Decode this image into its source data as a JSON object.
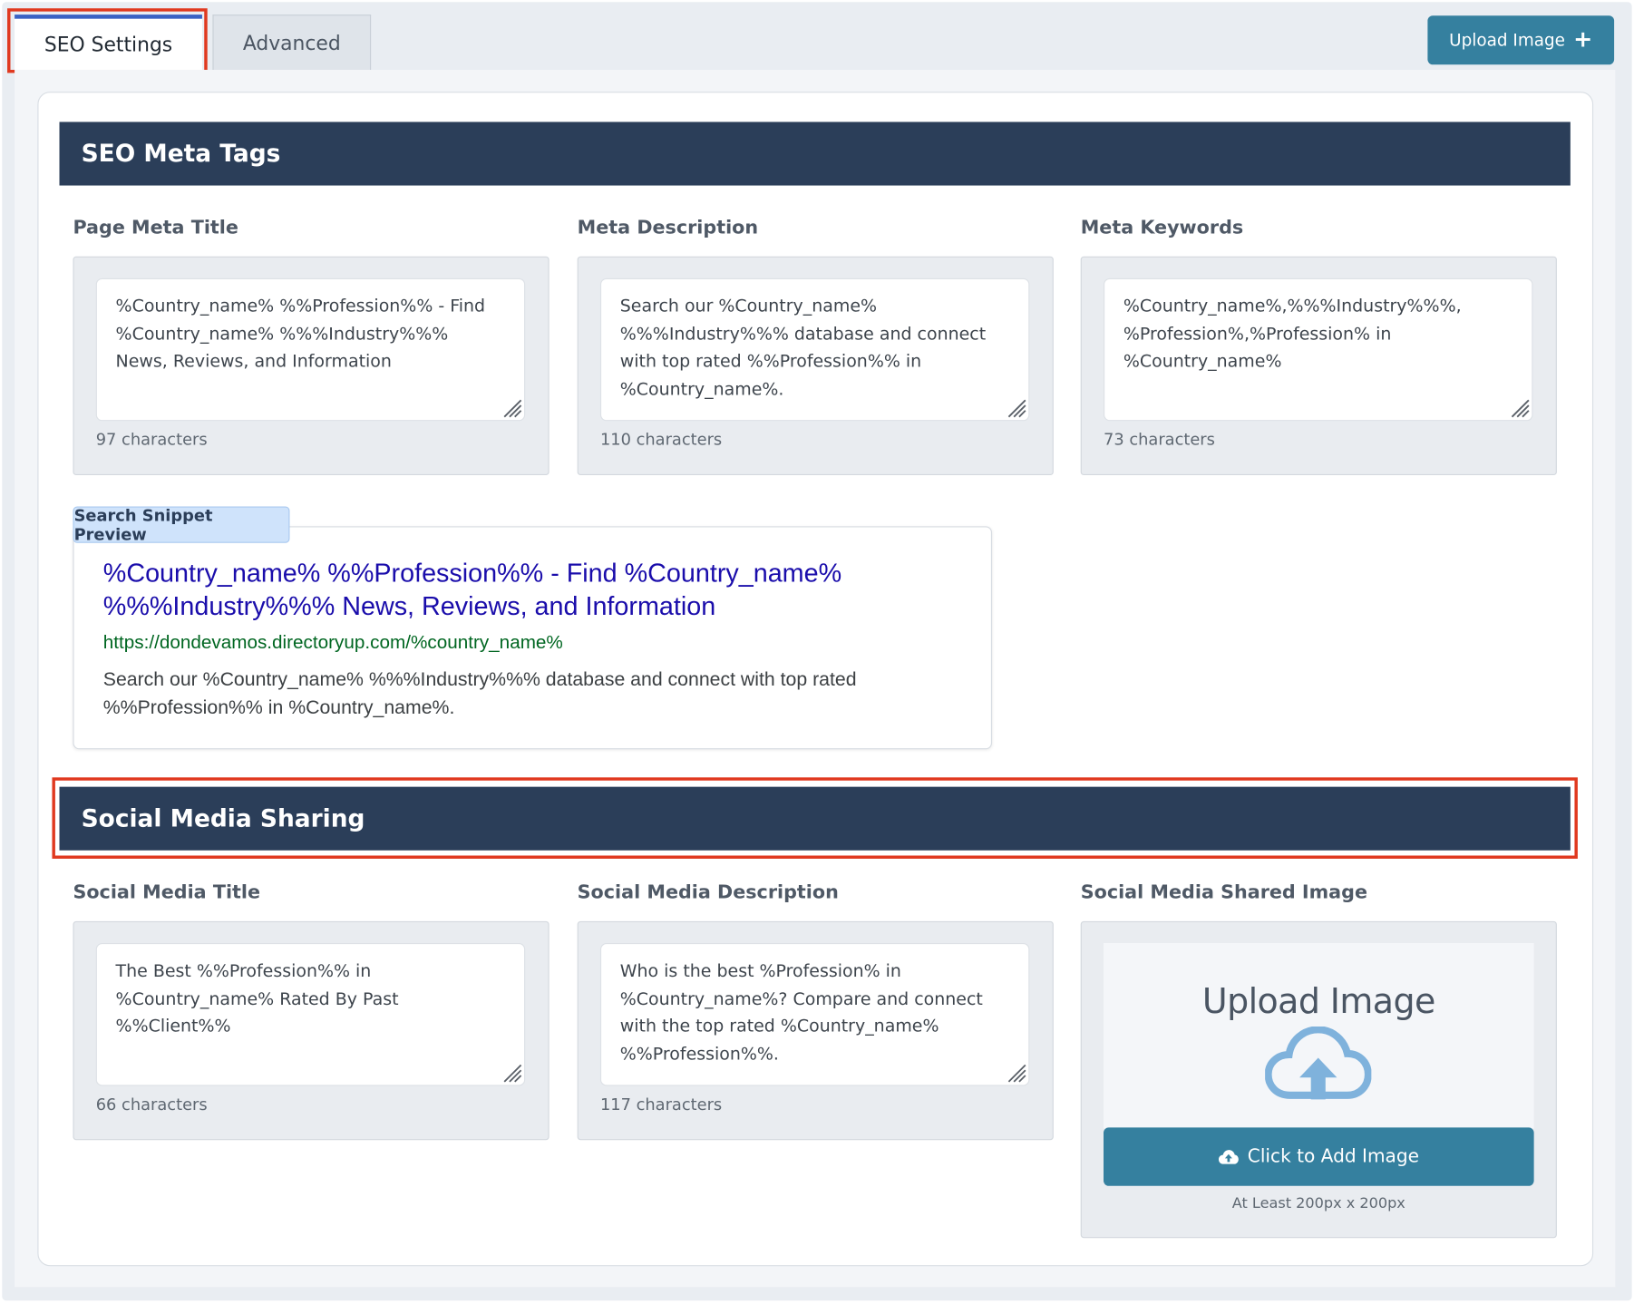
{
  "tabs": [
    {
      "label": "SEO Settings",
      "active": true
    },
    {
      "label": "Advanced",
      "active": false
    }
  ],
  "toolbar": {
    "upload_label": "Upload Image",
    "upload_icon": "plus-icon"
  },
  "seo_meta": {
    "heading": "SEO Meta Tags",
    "fields": [
      {
        "label": "Page Meta Title",
        "value": "%Country_name% %%Profession%% - Find %Country_name% %%%Industry%%% News, Reviews, and Information",
        "count": "97 characters"
      },
      {
        "label": "Meta Description",
        "value": "Search our %Country_name% %%%Industry%%% database and connect with top rated %%Profession%% in %Country_name%.",
        "count": "110 characters"
      },
      {
        "label": "Meta Keywords",
        "value": "%Country_name%,%%%Industry%%%, %Profession%,%Profession% in %Country_name%",
        "count": "73 characters"
      }
    ]
  },
  "snippet": {
    "badge": "Search Snippet Preview",
    "title": "%Country_name% %%Profession%% - Find %Country_name% %%%Industry%%% News, Reviews, and Information",
    "url": "https://dondevamos.directoryup.com/%country_name%",
    "description": "Search our %Country_name% %%%Industry%%% database and connect with top rated %%Profession%% in %Country_name%.",
    "title_color": "#1a0dab",
    "url_color": "#006621"
  },
  "social": {
    "heading": "Social Media Sharing",
    "fields": [
      {
        "label": "Social Media Title",
        "value": "The Best %%Profession%% in %Country_name% Rated By Past %%Client%%",
        "count": "66 characters"
      },
      {
        "label": "Social Media Description",
        "value": "Who is the best %Profession% in %Country_name%? Compare and connect with the top rated %Country_name% %%Profession%%.",
        "count": "117 characters"
      }
    ],
    "image": {
      "label": "Social Media Shared Image",
      "preview_text": "Upload Image",
      "button_label": "Click to Add Image",
      "hint": "At Least 200px x 200px",
      "icon": "cloud-upload-icon"
    }
  },
  "colors": {
    "header_bg": "#2b3e59",
    "button_bg": "#35809f",
    "highlight": "#e0391f",
    "active_tab_bar": "#3a62c4"
  }
}
